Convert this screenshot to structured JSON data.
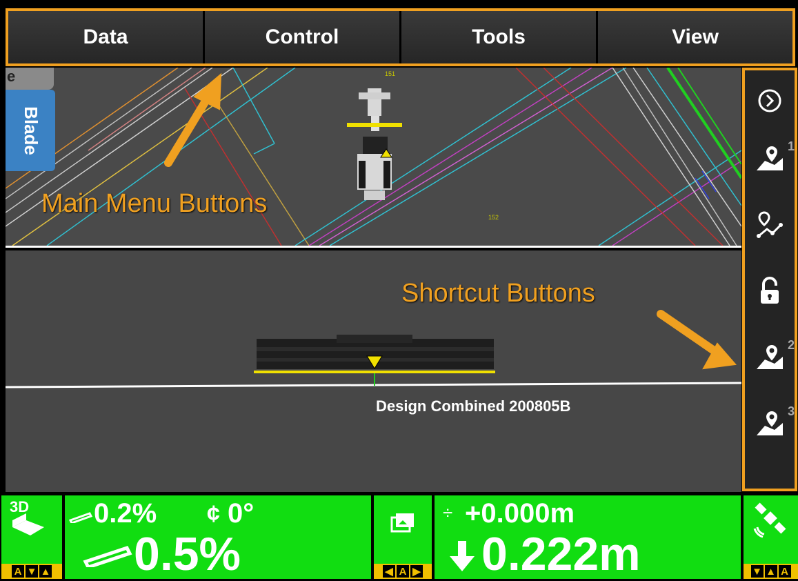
{
  "menu": {
    "items": [
      {
        "label": "Data"
      },
      {
        "label": "Control"
      },
      {
        "label": "Tools"
      },
      {
        "label": "View"
      }
    ]
  },
  "plan_view": {
    "side_tab_label": "Blade",
    "corner_tab_label": "e",
    "station_labels": [
      "151",
      "152"
    ]
  },
  "profile_view": {
    "design_name": "Design Combined 200805B"
  },
  "shortcuts": [
    {
      "icon": "chevron-right-circle-icon",
      "superscript": ""
    },
    {
      "icon": "map-pin-layer-icon",
      "superscript": "1"
    },
    {
      "icon": "route-points-icon",
      "superscript": ""
    },
    {
      "icon": "unlock-icon",
      "superscript": ""
    },
    {
      "icon": "map-pin-layer-icon",
      "superscript": "2"
    },
    {
      "icon": "map-pin-layer-icon",
      "superscript": "3"
    }
  ],
  "annotations": {
    "main_menu": "Main Menu Buttons",
    "shortcuts": "Shortcut Buttons"
  },
  "status": {
    "mode_label": "3D",
    "cross_slope_target": "0.2%",
    "rotation": "0°",
    "cross_slope_actual": "0.5%",
    "elevation_offset": "+0.000m",
    "cut_fill": "0.222m",
    "auto_label": "A"
  },
  "colors": {
    "accent": "#f0a020",
    "status_green": "#11dd11",
    "background": "#474747",
    "blade_tab": "#3b82c4"
  }
}
